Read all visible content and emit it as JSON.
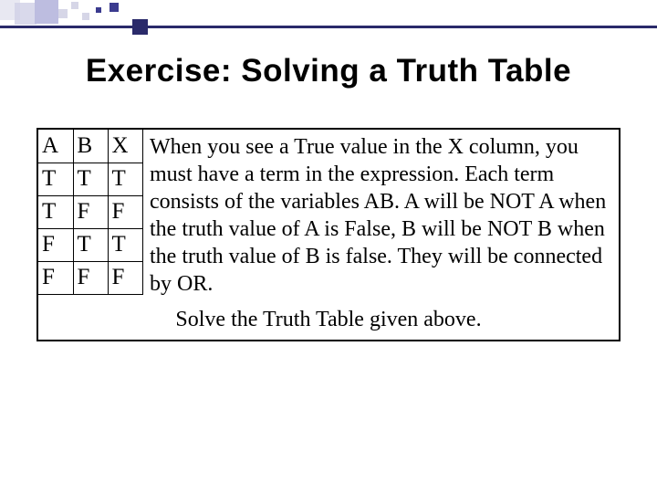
{
  "title": "Exercise:  Solving a Truth Table",
  "table": {
    "headers": [
      "A",
      "B",
      "X"
    ],
    "rows": [
      [
        "T",
        "T",
        "T"
      ],
      [
        "T",
        "F",
        "F"
      ],
      [
        "F",
        "T",
        "T"
      ],
      [
        "F",
        "F",
        "F"
      ]
    ]
  },
  "explanation": "When you see a True value in the X column, you must have a term in the expression.  Each term consists of the variables AB.  A will be NOT A when the truth value of A is False, B will be NOT B when the truth value of B is false.  They will be connected by OR.",
  "prompt": "Solve the Truth Table given above."
}
